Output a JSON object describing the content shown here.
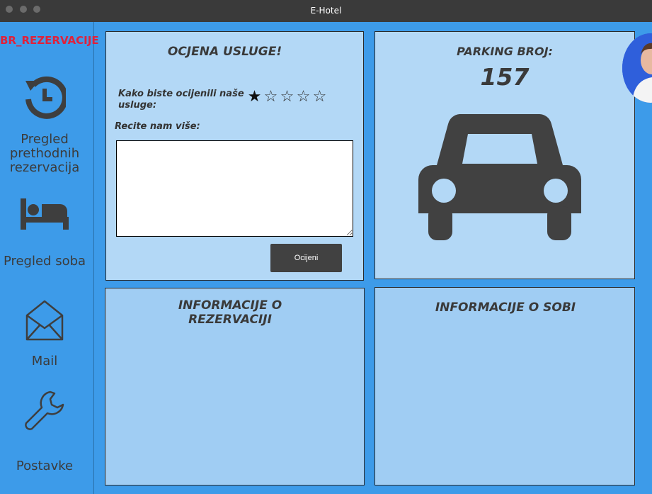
{
  "window": {
    "title": "E-Hotel"
  },
  "sidebar": {
    "reservation_label": "BR_REZERVACIJE",
    "items": [
      {
        "label": "Pregled prethodnih rezervacija",
        "icon": "history-icon"
      },
      {
        "label": "Pregled soba",
        "icon": "bed-icon"
      },
      {
        "label": "Mail",
        "icon": "mail-icon"
      },
      {
        "label": "Postavke",
        "icon": "wrench-icon"
      }
    ]
  },
  "rating": {
    "title": "OCJENA USLUGE!",
    "question": "Kako biste ocijenili naše usluge:",
    "stars_total": 5,
    "stars_selected": 1,
    "more_label": "Recite nam više:",
    "comment_value": "",
    "submit_label": "Ocijeni"
  },
  "parking": {
    "title": "PARKING BROJ:",
    "number": "157",
    "icon": "car-icon"
  },
  "reservation_info": {
    "title": "INFORMACIJE O REZERVACIJI"
  },
  "room_info": {
    "title": "INFORMACIJE O SOBI"
  },
  "colors": {
    "background": "#3d9be9",
    "panel": "#b3d8f6",
    "panel_lower": "#a0cdf3",
    "titlebar": "#3a3a3a",
    "accent_red": "#e0213b",
    "dark": "#414141"
  }
}
